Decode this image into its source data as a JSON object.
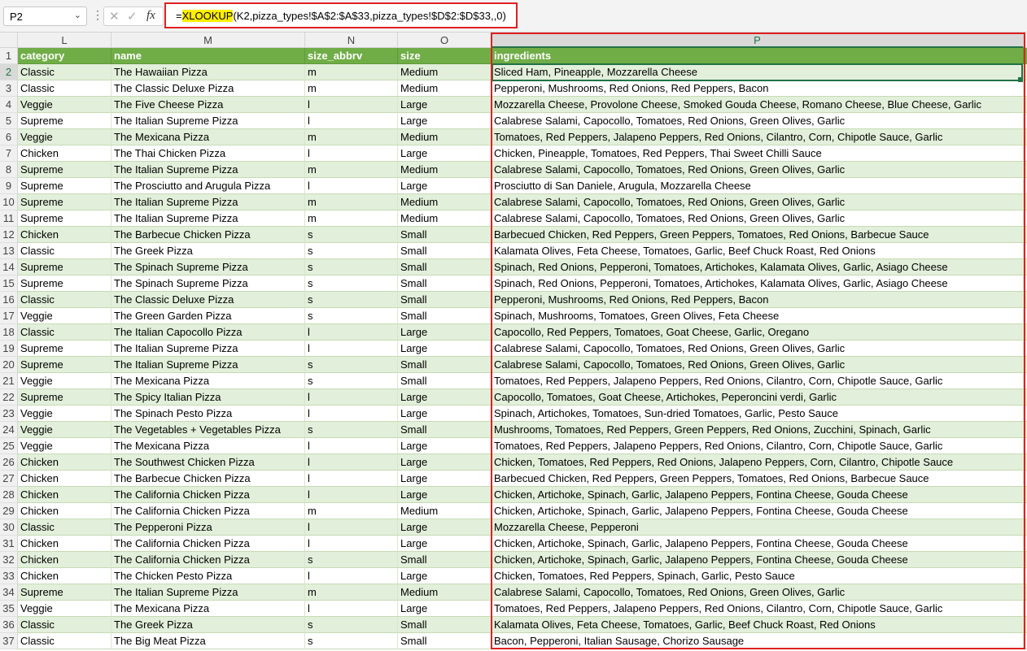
{
  "name_box": "P2",
  "formula": {
    "prefix": "=",
    "function": "XLOOKUP",
    "rest": "(K2,pizza_types!$A$2:$A$33,pizza_types!$D$2:$D$33,,0)"
  },
  "columns": [
    "L",
    "M",
    "N",
    "O",
    "P"
  ],
  "headers": [
    "category",
    "name",
    "size_abbrv",
    "size",
    "ingredients"
  ],
  "rows": [
    [
      "2",
      "Classic",
      "The Hawaiian Pizza",
      "m",
      "Medium",
      "Sliced Ham, Pineapple, Mozzarella Cheese"
    ],
    [
      "3",
      "Classic",
      "The Classic Deluxe Pizza",
      "m",
      "Medium",
      "Pepperoni, Mushrooms, Red Onions, Red Peppers, Bacon"
    ],
    [
      "4",
      "Veggie",
      "The Five Cheese Pizza",
      "l",
      "Large",
      "Mozzarella Cheese, Provolone Cheese, Smoked Gouda Cheese, Romano Cheese, Blue Cheese, Garlic"
    ],
    [
      "5",
      "Supreme",
      "The Italian Supreme Pizza",
      "l",
      "Large",
      "Calabrese Salami, Capocollo, Tomatoes, Red Onions, Green Olives, Garlic"
    ],
    [
      "6",
      "Veggie",
      "The Mexicana Pizza",
      "m",
      "Medium",
      "Tomatoes, Red Peppers, Jalapeno Peppers, Red Onions, Cilantro, Corn, Chipotle Sauce, Garlic"
    ],
    [
      "7",
      "Chicken",
      "The Thai Chicken Pizza",
      "l",
      "Large",
      "Chicken, Pineapple, Tomatoes, Red Peppers, Thai Sweet Chilli Sauce"
    ],
    [
      "8",
      "Supreme",
      "The Italian Supreme Pizza",
      "m",
      "Medium",
      "Calabrese Salami, Capocollo, Tomatoes, Red Onions, Green Olives, Garlic"
    ],
    [
      "9",
      "Supreme",
      "The Prosciutto and Arugula Pizza",
      "l",
      "Large",
      "Prosciutto di San Daniele, Arugula, Mozzarella Cheese"
    ],
    [
      "10",
      "Supreme",
      "The Italian Supreme Pizza",
      "m",
      "Medium",
      "Calabrese Salami, Capocollo, Tomatoes, Red Onions, Green Olives, Garlic"
    ],
    [
      "11",
      "Supreme",
      "The Italian Supreme Pizza",
      "m",
      "Medium",
      "Calabrese Salami, Capocollo, Tomatoes, Red Onions, Green Olives, Garlic"
    ],
    [
      "12",
      "Chicken",
      "The Barbecue Chicken Pizza",
      "s",
      "Small",
      "Barbecued Chicken, Red Peppers, Green Peppers, Tomatoes, Red Onions, Barbecue Sauce"
    ],
    [
      "13",
      "Classic",
      "The Greek Pizza",
      "s",
      "Small",
      "Kalamata Olives, Feta Cheese, Tomatoes, Garlic, Beef Chuck Roast, Red Onions"
    ],
    [
      "14",
      "Supreme",
      "The Spinach Supreme Pizza",
      "s",
      "Small",
      "Spinach, Red Onions, Pepperoni, Tomatoes, Artichokes, Kalamata Olives, Garlic, Asiago Cheese"
    ],
    [
      "15",
      "Supreme",
      "The Spinach Supreme Pizza",
      "s",
      "Small",
      "Spinach, Red Onions, Pepperoni, Tomatoes, Artichokes, Kalamata Olives, Garlic, Asiago Cheese"
    ],
    [
      "16",
      "Classic",
      "The Classic Deluxe Pizza",
      "s",
      "Small",
      "Pepperoni, Mushrooms, Red Onions, Red Peppers, Bacon"
    ],
    [
      "17",
      "Veggie",
      "The Green Garden Pizza",
      "s",
      "Small",
      "Spinach, Mushrooms, Tomatoes, Green Olives, Feta Cheese"
    ],
    [
      "18",
      "Classic",
      "The Italian Capocollo Pizza",
      "l",
      "Large",
      "Capocollo, Red Peppers, Tomatoes, Goat Cheese, Garlic, Oregano"
    ],
    [
      "19",
      "Supreme",
      "The Italian Supreme Pizza",
      "l",
      "Large",
      "Calabrese Salami, Capocollo, Tomatoes, Red Onions, Green Olives, Garlic"
    ],
    [
      "20",
      "Supreme",
      "The Italian Supreme Pizza",
      "s",
      "Small",
      "Calabrese Salami, Capocollo, Tomatoes, Red Onions, Green Olives, Garlic"
    ],
    [
      "21",
      "Veggie",
      "The Mexicana Pizza",
      "s",
      "Small",
      "Tomatoes, Red Peppers, Jalapeno Peppers, Red Onions, Cilantro, Corn, Chipotle Sauce, Garlic"
    ],
    [
      "22",
      "Supreme",
      "The Spicy Italian Pizza",
      "l",
      "Large",
      "Capocollo, Tomatoes, Goat Cheese, Artichokes, Peperoncini verdi, Garlic"
    ],
    [
      "23",
      "Veggie",
      "The Spinach Pesto Pizza",
      "l",
      "Large",
      "Spinach, Artichokes, Tomatoes, Sun-dried Tomatoes, Garlic, Pesto Sauce"
    ],
    [
      "24",
      "Veggie",
      "The Vegetables + Vegetables Pizza",
      "s",
      "Small",
      "Mushrooms, Tomatoes, Red Peppers, Green Peppers, Red Onions, Zucchini, Spinach, Garlic"
    ],
    [
      "25",
      "Veggie",
      "The Mexicana Pizza",
      "l",
      "Large",
      "Tomatoes, Red Peppers, Jalapeno Peppers, Red Onions, Cilantro, Corn, Chipotle Sauce, Garlic"
    ],
    [
      "26",
      "Chicken",
      "The Southwest Chicken Pizza",
      "l",
      "Large",
      "Chicken, Tomatoes, Red Peppers, Red Onions, Jalapeno Peppers, Corn, Cilantro, Chipotle Sauce"
    ],
    [
      "27",
      "Chicken",
      "The Barbecue Chicken Pizza",
      "l",
      "Large",
      "Barbecued Chicken, Red Peppers, Green Peppers, Tomatoes, Red Onions, Barbecue Sauce"
    ],
    [
      "28",
      "Chicken",
      "The California Chicken Pizza",
      "l",
      "Large",
      "Chicken, Artichoke, Spinach, Garlic, Jalapeno Peppers, Fontina Cheese, Gouda Cheese"
    ],
    [
      "29",
      "Chicken",
      "The California Chicken Pizza",
      "m",
      "Medium",
      "Chicken, Artichoke, Spinach, Garlic, Jalapeno Peppers, Fontina Cheese, Gouda Cheese"
    ],
    [
      "30",
      "Classic",
      "The Pepperoni Pizza",
      "l",
      "Large",
      "Mozzarella Cheese, Pepperoni"
    ],
    [
      "31",
      "Chicken",
      "The California Chicken Pizza",
      "l",
      "Large",
      "Chicken, Artichoke, Spinach, Garlic, Jalapeno Peppers, Fontina Cheese, Gouda Cheese"
    ],
    [
      "32",
      "Chicken",
      "The California Chicken Pizza",
      "s",
      "Small",
      "Chicken, Artichoke, Spinach, Garlic, Jalapeno Peppers, Fontina Cheese, Gouda Cheese"
    ],
    [
      "33",
      "Chicken",
      "The Chicken Pesto Pizza",
      "l",
      "Large",
      "Chicken, Tomatoes, Red Peppers, Spinach, Garlic, Pesto Sauce"
    ],
    [
      "34",
      "Supreme",
      "The Italian Supreme Pizza",
      "m",
      "Medium",
      "Calabrese Salami, Capocollo, Tomatoes, Red Onions, Green Olives, Garlic"
    ],
    [
      "35",
      "Veggie",
      "The Mexicana Pizza",
      "l",
      "Large",
      "Tomatoes, Red Peppers, Jalapeno Peppers, Red Onions, Cilantro, Corn, Chipotle Sauce, Garlic"
    ],
    [
      "36",
      "Classic",
      "The Greek Pizza",
      "s",
      "Small",
      "Kalamata Olives, Feta Cheese, Tomatoes, Garlic, Beef Chuck Roast, Red Onions"
    ],
    [
      "37",
      "Classic",
      "The Big Meat Pizza",
      "s",
      "Small",
      "Bacon, Pepperoni, Italian Sausage, Chorizo Sausage"
    ]
  ]
}
